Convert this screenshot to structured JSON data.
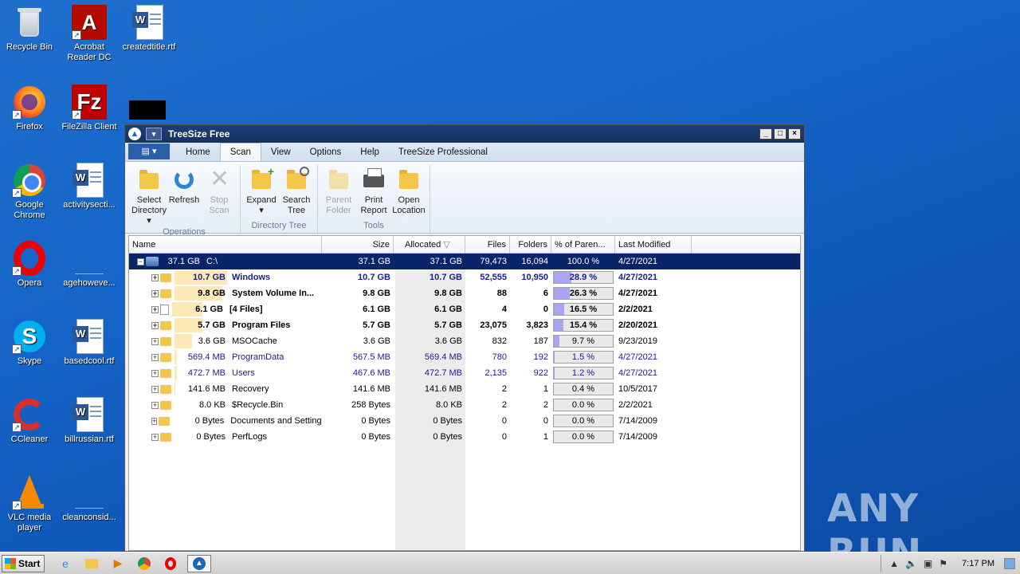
{
  "desktop": {
    "icons": [
      {
        "label": "Recycle Bin"
      },
      {
        "label": "Acrobat Reader DC"
      },
      {
        "label": "createdtitle.rtf"
      },
      {
        "label": "Firefox"
      },
      {
        "label": "FileZilla Client"
      },
      {
        "label": "Google Chrome"
      },
      {
        "label": "activitysecti..."
      },
      {
        "label": "Opera"
      },
      {
        "label": "agehoweve..."
      },
      {
        "label": "Skype"
      },
      {
        "label": "basedcool.rtf"
      },
      {
        "label": "CCleaner"
      },
      {
        "label": "billrussian.rtf"
      },
      {
        "label": "VLC media player"
      },
      {
        "label": "cleanconsid..."
      }
    ],
    "watermark": "ANY RUN"
  },
  "window": {
    "title": "TreeSize Free",
    "controls": {
      "minimize": "_",
      "maximize": "□",
      "close": "×"
    }
  },
  "ribbon": {
    "tabs": [
      "Home",
      "Scan",
      "View",
      "Options",
      "Help",
      "TreeSize Professional"
    ],
    "active_tab": "Scan",
    "groups": {
      "operations": {
        "label": "Operations",
        "buttons": [
          "Select Directory ▾",
          "Refresh",
          "Stop Scan"
        ]
      },
      "directory_tree": {
        "label": "Directory Tree",
        "buttons": [
          "Expand ▾",
          "Search Tree"
        ]
      },
      "tools": {
        "label": "Tools",
        "buttons": [
          "Parent Folder",
          "Print Report",
          "Open Location"
        ]
      }
    }
  },
  "table": {
    "headers": {
      "name": "Name",
      "size": "Size",
      "allocated": "Allocated",
      "files": "Files",
      "folders": "Folders",
      "pct": "% of Paren...",
      "modified": "Last Modified"
    },
    "root": {
      "bar_size": "37.1 GB",
      "name": "C:\\",
      "size": "37.1 GB",
      "allocated": "37.1 GB",
      "files": "79,473",
      "folders": "16,094",
      "pct": "100.0 %",
      "modified": "4/27/2021"
    },
    "rows": [
      {
        "bar_size": "10.7 GB",
        "name": "Windows",
        "size": "10.7 GB",
        "allocated": "10.7 GB",
        "files": "52,555",
        "folders": "10,950",
        "pct": "28.9 %",
        "pct_value": 28.9,
        "modified": "4/27/2021",
        "style": "bold navy",
        "icon": "folder"
      },
      {
        "bar_size": "9.8 GB",
        "name": "System Volume In...",
        "size": "9.8 GB",
        "allocated": "9.8 GB",
        "files": "88",
        "folders": "6",
        "pct": "26.3 %",
        "pct_value": 26.3,
        "modified": "4/27/2021",
        "style": "bold",
        "icon": "folder"
      },
      {
        "bar_size": "6.1 GB",
        "name": "[4 Files]",
        "size": "6.1 GB",
        "allocated": "6.1 GB",
        "files": "4",
        "folders": "0",
        "pct": "16.5 %",
        "pct_value": 16.5,
        "modified": "2/2/2021",
        "style": "bold",
        "icon": "file"
      },
      {
        "bar_size": "5.7 GB",
        "name": "Program Files",
        "size": "5.7 GB",
        "allocated": "5.7 GB",
        "files": "23,075",
        "folders": "3,823",
        "pct": "15.4 %",
        "pct_value": 15.4,
        "modified": "2/20/2021",
        "style": "bold",
        "icon": "folder"
      },
      {
        "bar_size": "3.6 GB",
        "name": "MSOCache",
        "size": "3.6 GB",
        "allocated": "3.6 GB",
        "files": "832",
        "folders": "187",
        "pct": "9.7 %",
        "pct_value": 9.7,
        "modified": "9/23/2019",
        "style": "",
        "icon": "folder"
      },
      {
        "bar_size": "569.4 MB",
        "name": "ProgramData",
        "size": "567.5 MB",
        "allocated": "569.4 MB",
        "files": "780",
        "folders": "192",
        "pct": "1.5 %",
        "pct_value": 1.5,
        "modified": "4/27/2021",
        "style": "navy",
        "icon": "folder"
      },
      {
        "bar_size": "472.7 MB",
        "name": "Users",
        "size": "467.6 MB",
        "allocated": "472.7 MB",
        "files": "2,135",
        "folders": "922",
        "pct": "1.2 %",
        "pct_value": 1.2,
        "modified": "4/27/2021",
        "style": "navy",
        "icon": "folder"
      },
      {
        "bar_size": "141.6 MB",
        "name": "Recovery",
        "size": "141.6 MB",
        "allocated": "141.6 MB",
        "files": "2",
        "folders": "1",
        "pct": "0.4 %",
        "pct_value": 0.4,
        "modified": "10/5/2017",
        "style": "",
        "icon": "folder"
      },
      {
        "bar_size": "8.0 KB",
        "name": "$Recycle.Bin",
        "size": "258 Bytes",
        "allocated": "8.0 KB",
        "files": "2",
        "folders": "2",
        "pct": "0.0 %",
        "pct_value": 0.0,
        "modified": "2/2/2021",
        "style": "",
        "icon": "folder"
      },
      {
        "bar_size": "0 Bytes",
        "name": "Documents and Settings",
        "size": "0 Bytes",
        "allocated": "0 Bytes",
        "files": "0",
        "folders": "0",
        "pct": "0.0 %",
        "pct_value": 0.0,
        "modified": "7/14/2009",
        "style": "",
        "icon": "folder"
      },
      {
        "bar_size": "0 Bytes",
        "name": "PerfLogs",
        "size": "0 Bytes",
        "allocated": "0 Bytes",
        "files": "0",
        "folders": "1",
        "pct": "0.0 %",
        "pct_value": 0.0,
        "modified": "7/14/2009",
        "style": "",
        "icon": "folder"
      }
    ]
  },
  "taskbar": {
    "start_label": "Start",
    "clock": "7:17 PM",
    "pinned": [
      "ie-icon",
      "explorer-icon",
      "media-player-icon",
      "chrome-icon",
      "opera-icon",
      "treesize-icon"
    ]
  }
}
